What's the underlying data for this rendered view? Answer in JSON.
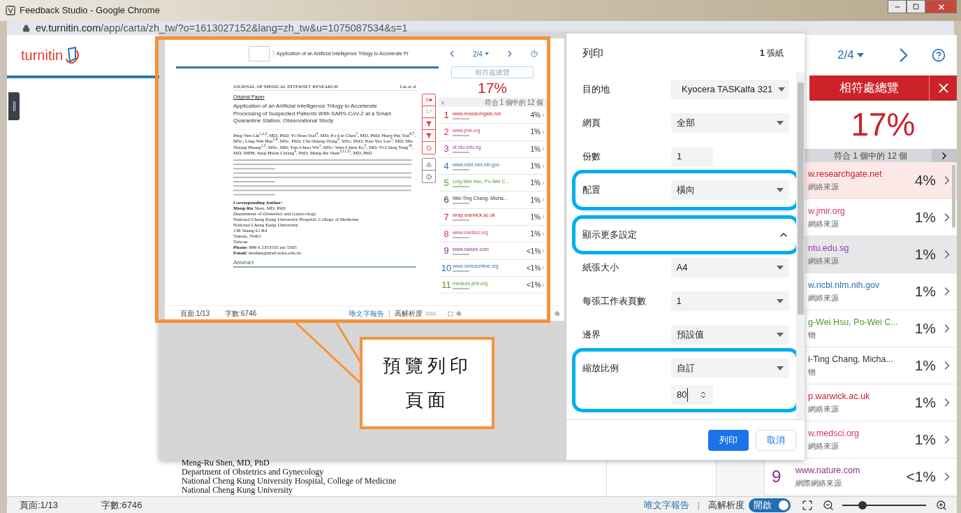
{
  "browser": {
    "title": "Feedback Studio - Google Chrome",
    "url_host": "ev.turnitin.com",
    "url_path": "/app/carta/zh_tw/?o=1613027152&lang=zh_tw&u=1075087534&s=1"
  },
  "app": {
    "logo": "turnitin",
    "pager": "2/4"
  },
  "document": {
    "lines": [
      "Meng-Ru Shen, MD, PhD",
      "Department of Obstetrics and Gynecology",
      "National Cheng Kung University Hospital, College of Medicine",
      "National Cheng Kung University"
    ]
  },
  "match_panel": {
    "title": "相符處總覽",
    "score": "17%",
    "filter": "符合 1 個中的 12 個",
    "sources": [
      {
        "name": "w.researchgate.net",
        "type": "網絡來源",
        "percent": "4%",
        "color": "#c8202a",
        "selected": true,
        "hovered": false
      },
      {
        "name": "w.jmir.org",
        "type": "網絡來源",
        "percent": "1%",
        "color": "#d6336c",
        "selected": false,
        "hovered": false
      },
      {
        "name": "ntu.edu.sg",
        "type": "網絡來源",
        "percent": "1%",
        "color": "#9c36b5",
        "selected": false,
        "hovered": true
      },
      {
        "name": "w.ncbi.nlm.nih.gov",
        "type": "網絡來源",
        "percent": "1%",
        "color": "#2f6fb5",
        "selected": false,
        "hovered": false
      },
      {
        "name": "g-Wei Hsu, Po-Wei C...",
        "type": "物",
        "percent": "1%",
        "color": "#4c9a2a",
        "selected": false,
        "hovered": false
      },
      {
        "name": "i-Ting Chang, Micha...",
        "type": "物",
        "percent": "1%",
        "color": "#333333",
        "selected": false,
        "hovered": false
      },
      {
        "name": "p.warwick.ac.uk",
        "type": "網絡來源",
        "percent": "1%",
        "color": "#c8202a",
        "selected": false,
        "hovered": false
      },
      {
        "name": "w.medsci.org",
        "type": "網絡來源",
        "percent": "1%",
        "color": "#d6336c",
        "selected": false,
        "hovered": false
      },
      {
        "number": "9",
        "name": "www.nature.com",
        "type": "網際網絡來源",
        "percent": "<1%",
        "color": "#8e2c8e",
        "selected": false,
        "hovered": false
      }
    ]
  },
  "status_bar": {
    "page": "頁面:1/13",
    "words": "字數:6746",
    "text_report": "唯文字報告",
    "separator": "|",
    "high_res": "高解析度",
    "toggle": "開啟",
    "on": true,
    "zoom": {
      "level": 0.24
    }
  },
  "print_dialog": {
    "title": "列印",
    "sheets": "**1** 張紙",
    "settings": [
      {
        "kind": "destination",
        "label": "目的地",
        "value": "Kyocera TASKalfa 321",
        "highlighted": false
      },
      {
        "kind": "select",
        "label": "網頁",
        "value": "全部",
        "highlighted": false
      },
      {
        "kind": "number",
        "label": "份數",
        "value": "1",
        "highlighted": false
      },
      {
        "kind": "select",
        "label": "配置",
        "value": "橫向",
        "highlighted": true
      },
      {
        "kind": "expander",
        "label": "顯示更多設定",
        "expanded": true,
        "highlighted": true
      },
      {
        "kind": "select",
        "label": "紙張大小",
        "value": "A4",
        "highlighted": false
      },
      {
        "kind": "select",
        "label": "每張工作表頁數",
        "value": "1",
        "highlighted": false
      },
      {
        "kind": "select",
        "label": "邊界",
        "value": "預設值",
        "highlighted": false
      },
      {
        "kind": "scale",
        "label": "縮放比例",
        "value": "自訂",
        "number": "80",
        "highlighted": true
      }
    ],
    "buttons": [
      {
        "label": "列印",
        "primary": true
      },
      {
        "label": "取消",
        "primary": false
      }
    ]
  },
  "preview": {
    "header_title": "Application of an Artificial Intelligence Trilogy to Accelerate Pr",
    "journal": "JOURNAL OF MEDICAL INTERNET RESEARCH",
    "running_author": "Liu et al",
    "section": "Original Paper",
    "title_lines": [
      "Application of an Artificial Intelligence Trilogy to Accelerate",
      "Processing of Suspected Patients With SARS-CoV-2 at a Smart",
      "Quarantine Station: Observational Study"
    ],
    "authors": "Ping-Yen Liu$^{1,2,3}$, MD, PhD; Yi-Shan Tsai$^{4}$, MD; Po-Lin Chen$^{5}$, MD, PhD; Huey-Pin Tsai$^{6,7}$, MSc; Ling-Wei Hsu$^{1,8}$, MSc, PhD; Chi-Shiang Wang$^{9}$, MSc, PhD; Nan-Yao Lee$^{5}$, MD; Mu-Shiang Huang$^{1,2}$, MSc, MD; Yan-Chiao Wu$^{1}$, MSc; Wen-Chien Ko$^{5}$, MD; Yi-Ching Yang$^{10}$, MD, MPH; Jung-Hsien Chiang$^{9}$, PhD; Meng-Ru Shen$^{3,11,12}$, MD, PhD",
    "contact_lines": [
      "**Corresponding Author:**",
      "**Meng-Ru** Shen, MD, PhD",
      "Department of Obstetrics and Gynecology",
      "National Cheng Kung University Hospital, College of Medicine",
      "National Cheng Kung University",
      "138 Sheng-Li Rd",
      "Tainan, 70401",
      "Taiwan",
      "**Phone:** 886 6 2353535 ext 5505",
      "**Email:** mrshen@mail.ncku.edu.tw"
    ],
    "abstract": "Abstract",
    "toolbar": {
      "flags": "0",
      "count": "17"
    },
    "sidebar": {
      "pager": "2/4",
      "title": "相符處總覽",
      "score": "17%",
      "filter": "符合 1 個中的 12 個",
      "sources": [
        {
          "number": "1",
          "name": "www.researchgate.net",
          "percent": "4%",
          "color": "#c8202a"
        },
        {
          "number": "2",
          "name": "www.jmir.org",
          "percent": "1%",
          "color": "#d6336c"
        },
        {
          "number": "3",
          "name": "dr.ntu.edu.sg",
          "percent": "1%",
          "color": "#9c36b5"
        },
        {
          "number": "4",
          "name": "www.ncbi.nlm.nih.gov",
          "percent": "1%",
          "color": "#2f6fb5"
        },
        {
          "number": "5",
          "name": "Ling-Wei Hsu, Po-Wei C...",
          "percent": "1%",
          "color": "#4c9a2a"
        },
        {
          "number": "6",
          "name": "Wei-Ting Chang, Micha...",
          "percent": "1%",
          "color": "#333333"
        },
        {
          "number": "7",
          "name": "wrap.warwick.ac.uk",
          "percent": "1%",
          "color": "#c8202a"
        },
        {
          "number": "8",
          "name": "www.medsci.org",
          "percent": "1%",
          "color": "#d6336c"
        },
        {
          "number": "9",
          "name": "www.nature.com",
          "percent": "<1%",
          "color": "#8e2c8e"
        },
        {
          "number": "10",
          "name": "www.omicsonline.org",
          "percent": "<1%",
          "color": "#2f6fb5"
        },
        {
          "number": "11",
          "name": "mededu.jmir.org",
          "percent": "<1%",
          "color": "#4c9a2a"
        }
      ]
    },
    "status": {
      "page": "頁面:1/13",
      "words": "字數:6746",
      "text_report": "唯文字報告",
      "separator": "|",
      "high_res": "高解析度",
      "on": false
    }
  },
  "callout": {
    "lines": [
      "預覽列印",
      "頁面"
    ]
  }
}
